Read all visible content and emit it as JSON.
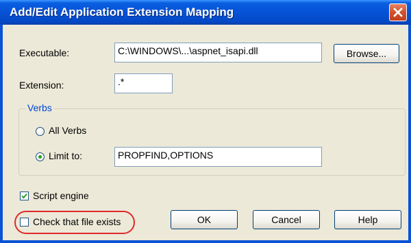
{
  "window": {
    "title": "Add/Edit Application Extension Mapping",
    "close_icon": "close-icon"
  },
  "executable": {
    "label": "Executable:",
    "value": "C:\\WINDOWS\\...\\aspnet_isapi.dll",
    "browse_label": "Browse..."
  },
  "extension": {
    "label": "Extension:",
    "value": ".*"
  },
  "verbs": {
    "legend": "Verbs",
    "all_verbs_label": "All Verbs",
    "limit_to_label": "Limit to:",
    "limit_to_value": "PROPFIND,OPTIONS",
    "selected": "limit_to"
  },
  "options": {
    "script_engine_label": "Script engine",
    "script_engine_checked": true,
    "check_file_exists_label": "Check that file exists",
    "check_file_exists_checked": false
  },
  "buttons": {
    "ok_label": "OK",
    "cancel_label": "Cancel",
    "help_label": "Help"
  },
  "colors": {
    "title_bar": "#0654d8",
    "close_button": "#d1512f",
    "dialog_background": "#ece9d8",
    "group_legend": "#0046d5",
    "highlight_ring": "#e0282a",
    "radio_dot": "#21a121",
    "check_mark": "#21a121"
  }
}
